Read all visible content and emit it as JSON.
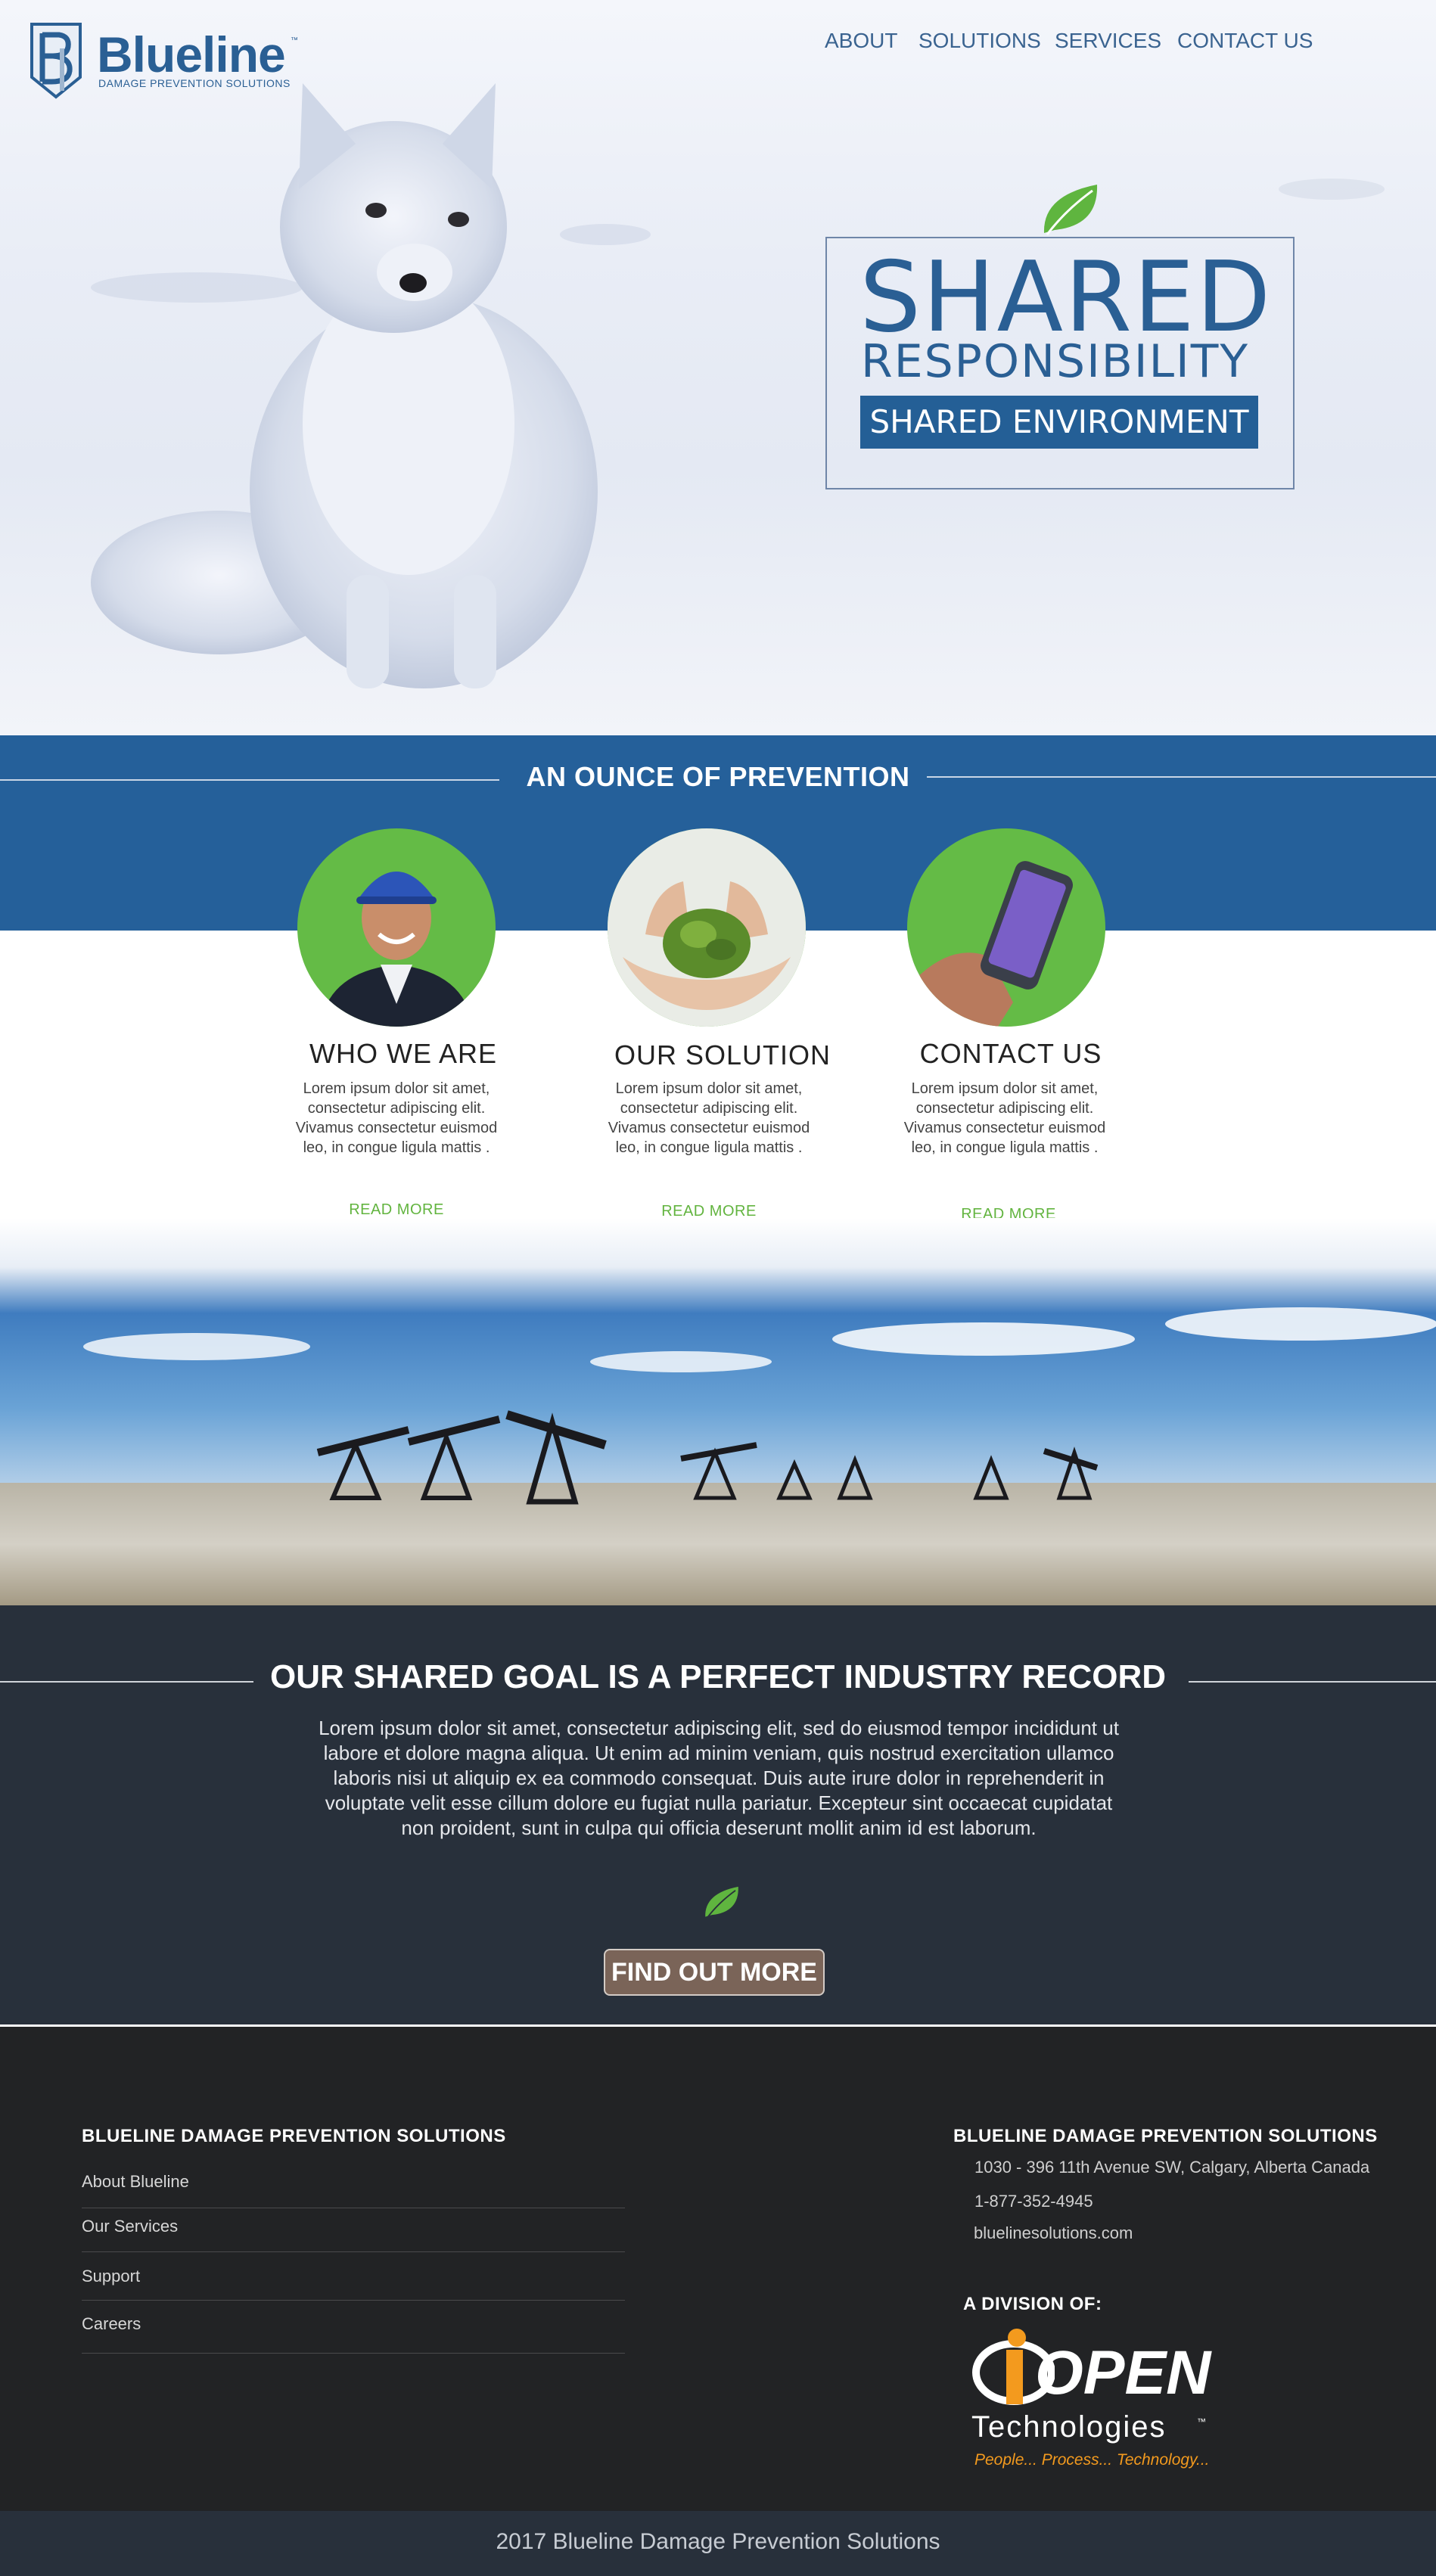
{
  "header": {
    "logo": {
      "name": "Blueline",
      "trademark": "™",
      "subtitle": "DAMAGE PREVENTION SOLUTIONS"
    },
    "nav": [
      {
        "label": "ABOUT"
      },
      {
        "label": "SOLUTIONS"
      },
      {
        "label": "SERVICES"
      },
      {
        "label": "CONTACT US"
      }
    ]
  },
  "hero": {
    "line1": "SHARED",
    "line2": "RESPONSIBILITY",
    "line3": "SHARED ENVIRONMENT"
  },
  "prevention": {
    "title": "AN OUNCE OF PREVENTION",
    "cards": [
      {
        "title": "WHO WE ARE",
        "text": "Lorem ipsum dolor sit amet, consectetur adipiscing elit. Vivamus consectetur euismod leo, in congue ligula mattis .",
        "link": "READ MORE"
      },
      {
        "title": "OUR SOLUTION",
        "text": "Lorem ipsum dolor sit amet, consectetur adipiscing elit. Vivamus consectetur euismod leo, in congue ligula mattis .",
        "link": "READ MORE"
      },
      {
        "title": "CONTACT US",
        "text": "Lorem ipsum dolor sit amet, consectetur adipiscing elit. Vivamus consectetur euismod leo, in congue ligula mattis .",
        "link": "READ MORE"
      }
    ]
  },
  "goal": {
    "title": "OUR SHARED GOAL IS A PERFECT INDUSTRY RECORD",
    "text": "Lorem ipsum dolor sit amet, consectetur adipiscing elit, sed do eiusmod tempor incididunt ut labore et dolore magna aliqua. Ut enim ad minim veniam, quis nostrud exercitation ullamco laboris nisi ut aliquip ex ea commodo consequat. Duis aute irure dolor in reprehenderit in voluptate velit esse cillum dolore eu fugiat nulla pariatur. Excepteur sint occaecat cupidatat non proident, sunt in culpa qui officia deserunt mollit anim id est laborum.",
    "button": "FIND OUT MORE"
  },
  "footer": {
    "left_heading": "BLUELINE DAMAGE PREVENTION SOLUTIONS",
    "links": [
      {
        "label": "About Blueline"
      },
      {
        "label": "Our Services"
      },
      {
        "label": "Support"
      },
      {
        "label": "Careers"
      }
    ],
    "right_heading": "BLUELINE DAMAGE PREVENTION SOLUTIONS",
    "address": "1030 - 396 11th Avenue SW, Calgary, Alberta Canada",
    "phone": "1-877-352-4945",
    "website": "bluelinesolutions.com",
    "division_label": "A DIVISION OF:",
    "division_logo": {
      "name": "OPEN",
      "word": "Technologies",
      "trademark": "™",
      "slogan": "People... Process... Technology..."
    },
    "copyright": "2017 Blueline Damage Prevention Solutions"
  },
  "colors": {
    "brand_blue": "#25609a",
    "accent_green": "#64bb46",
    "dark_slate": "#28303b",
    "footer_dark": "#222325",
    "button_brown": "#7a6458"
  }
}
